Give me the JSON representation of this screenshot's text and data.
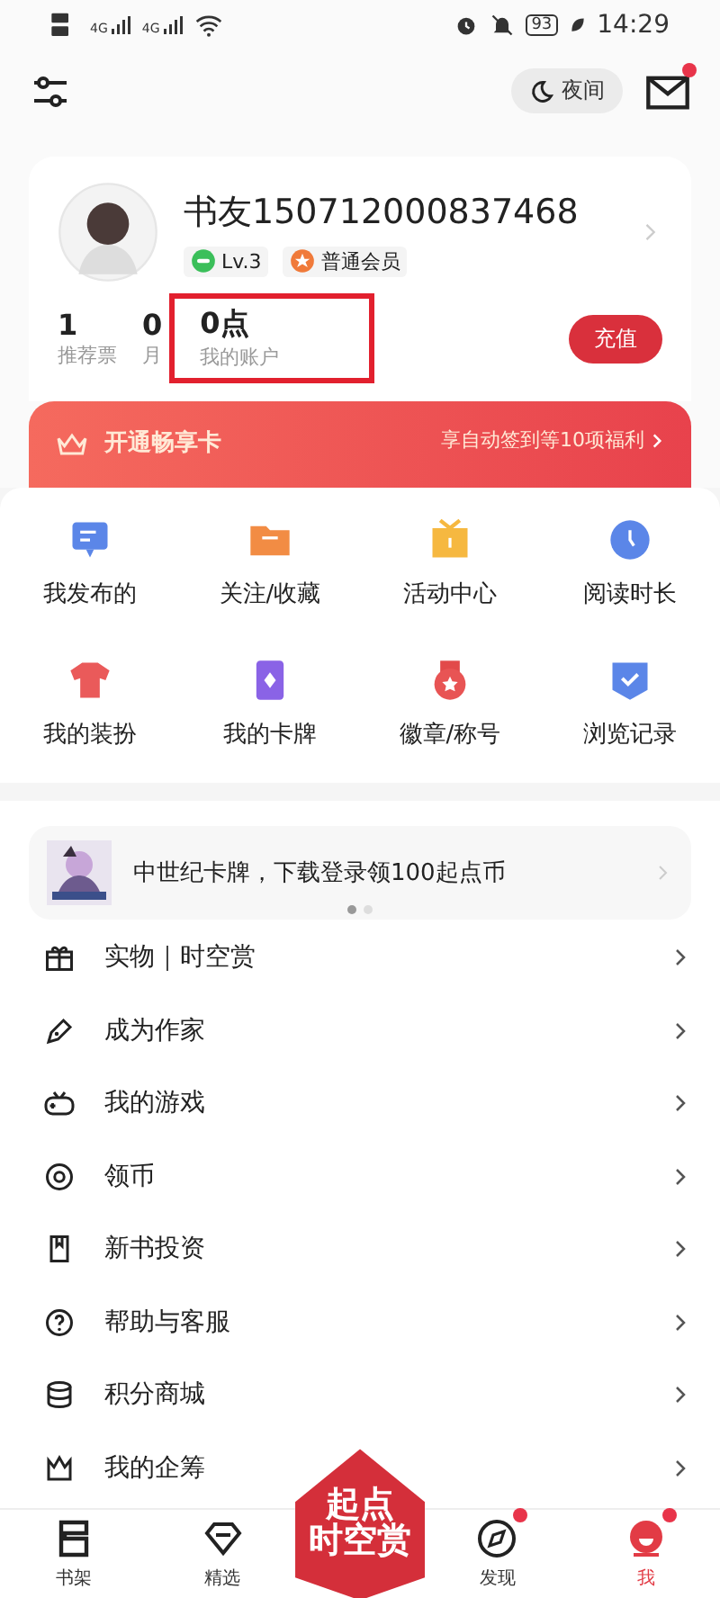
{
  "status_bar": {
    "network": [
      "4G",
      "4G"
    ],
    "battery": "93",
    "time": "14:29"
  },
  "header": {
    "night_mode": "夜间",
    "mail_unread": true
  },
  "profile": {
    "name": "书友150712000837468",
    "level": "Lv.3",
    "membership": "普通会员",
    "recharge": "充值",
    "stats": [
      {
        "value": "1",
        "label": "推荐票",
        "highlighted": false
      },
      {
        "value": "0",
        "label": "月",
        "highlighted": false
      },
      {
        "value": "0点",
        "label": "我的账户",
        "highlighted": true
      }
    ]
  },
  "vip_card": {
    "title": "开通畅享卡",
    "benefit": "享自动签到等10项福利"
  },
  "shortcuts": [
    {
      "label": "我发布的",
      "kind": "message"
    },
    {
      "label": "关注/收藏",
      "kind": "folder"
    },
    {
      "label": "活动中心",
      "kind": "gift"
    },
    {
      "label": "阅读时长",
      "kind": "clock"
    },
    {
      "label": "我的装扮",
      "kind": "shirt"
    },
    {
      "label": "我的卡牌",
      "kind": "card"
    },
    {
      "label": "徽章/称号",
      "kind": "medal"
    },
    {
      "label": "浏览记录",
      "kind": "shield"
    }
  ],
  "promo": {
    "text": "中世纪卡牌，下载登录领100起点币",
    "pages": [
      {
        "selected": true
      },
      {
        "selected": false
      }
    ]
  },
  "menu": [
    {
      "label": "实物｜时空赏",
      "kind": "gift"
    },
    {
      "label": "成为作家",
      "kind": "pen"
    },
    {
      "label": "我的游戏",
      "kind": "gamepad"
    },
    {
      "label": "领币",
      "kind": "at"
    },
    {
      "label": "新书投资",
      "kind": "bookmark"
    },
    {
      "label": "帮助与客服",
      "kind": "help"
    },
    {
      "label": "积分商城",
      "kind": "coins"
    },
    {
      "label": "我的企筹",
      "kind": "crown"
    }
  ],
  "tabs": [
    {
      "kind": "tab",
      "label": "书架",
      "selected": false,
      "badge": false
    },
    {
      "kind": "tab",
      "label": "精选",
      "selected": false,
      "badge": false
    },
    {
      "kind": "logo",
      "lines": [
        "起点",
        "时空赏"
      ]
    },
    {
      "kind": "tab",
      "label": "发现",
      "selected": false,
      "badge": true
    },
    {
      "kind": "tab",
      "label": "我",
      "selected": true,
      "badge": true
    }
  ]
}
